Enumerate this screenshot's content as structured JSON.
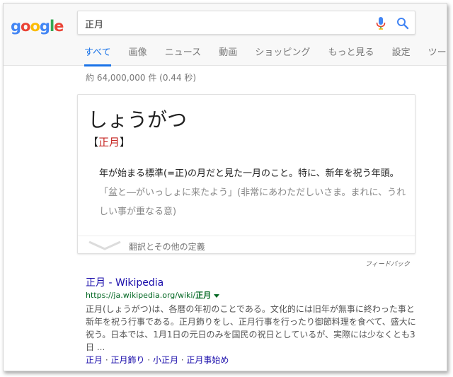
{
  "logo": {
    "text": "google",
    "colors": [
      "#4285f4",
      "#ea4335",
      "#fbbc05",
      "#4285f4",
      "#34a853",
      "#ea4335"
    ]
  },
  "search": {
    "query": "正月"
  },
  "tabs": [
    {
      "label": "すべて",
      "active": true
    },
    {
      "label": "画像"
    },
    {
      "label": "ニュース"
    },
    {
      "label": "動画"
    },
    {
      "label": "ショッピング"
    },
    {
      "label": "もっと見る"
    },
    {
      "label": "設定"
    },
    {
      "label": "ツール"
    }
  ],
  "result_stats": {
    "prefix": "約 ",
    "count": "64,000,000",
    "middle": " 件 (",
    "time": "0.44",
    "suffix": " 秒)"
  },
  "dictionary": {
    "reading": "しょうがつ",
    "bracket_open": "【",
    "word": "正月",
    "bracket_close": "】",
    "definition": "年が始まる標準(=正)の月だと見た一月のこと。特に、新年を祝う年頭。",
    "example": "「盆と―がいっしょに来たよう」(非常にあわただしいさま。まれに、うれしい事が重なる意)",
    "more_label": "翻訳とその他の定義"
  },
  "feedback": "フィードバック",
  "result": {
    "title": "正月 - Wikipedia",
    "url_prefix": "https://ja.wikipedia.org/wiki/",
    "url_bold": "正月",
    "snippet": "正月(しょうがつ)は、各暦の年初のことである。文化的には旧年が無事に終わった事と新年を祝う行事である。正月飾りをし、正月行事を行ったり御節料理を食べて、盛大に祝う。日本では、1月1日の元日のみを国民の祝日としているが、実際には少なくとも3日 ...",
    "sitelinks": [
      "正月",
      "正月飾り",
      "小正月",
      "正月事始め"
    ],
    "sitelink_separator": " · "
  }
}
